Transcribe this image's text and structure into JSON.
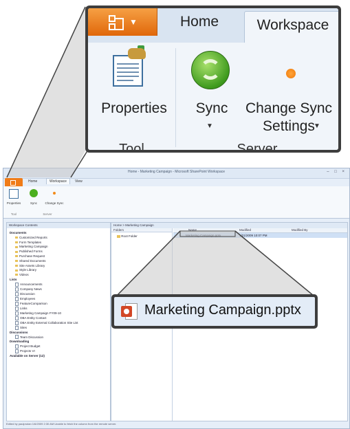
{
  "ribbon": {
    "tabs": [
      "Home",
      "Workspace"
    ],
    "groups": {
      "tool": {
        "name": "Tool",
        "properties_label": "Properties"
      },
      "server": {
        "name": "Server",
        "sync_label": "Sync",
        "change_sync_line1": "Change Sync",
        "change_sync_line2": "Settings"
      }
    },
    "file_button_icon": "office-file-menu-icon",
    "colors": {
      "file_button": "#e8720e",
      "sync": "#4caf1f",
      "change_sync_dot": "#f28a1a"
    }
  },
  "window": {
    "title": "Home - Marketing Campaign - Microsoft SharePoint Workspace",
    "tabs": [
      "Home",
      "Workspace",
      "View"
    ],
    "left_panel_header": "Workspace Contents",
    "right_panel_header": "Home > Marketing Campaign",
    "folders_header": "Folders",
    "root_folder": "Root Folder",
    "columns": [
      "Name",
      "Modified",
      "Modified By"
    ],
    "tree": [
      {
        "label": "Documents",
        "kind": "header"
      },
      {
        "label": "Customized Reports",
        "kind": "folder"
      },
      {
        "label": "Form Templates",
        "kind": "folder"
      },
      {
        "label": "Marketing Campaign",
        "kind": "folder"
      },
      {
        "label": "Published Forms",
        "kind": "folder"
      },
      {
        "label": "Purchase Request",
        "kind": "folder"
      },
      {
        "label": "Shared Documents",
        "kind": "folder"
      },
      {
        "label": "Site Assets Library",
        "kind": "folder"
      },
      {
        "label": "Style Library",
        "kind": "folder"
      },
      {
        "label": "Videos",
        "kind": "folder"
      },
      {
        "label": "Lists",
        "kind": "header"
      },
      {
        "label": "Announcements",
        "kind": "doc"
      },
      {
        "label": "Company News",
        "kind": "doc"
      },
      {
        "label": "Discussion",
        "kind": "doc"
      },
      {
        "label": "Employees",
        "kind": "doc"
      },
      {
        "label": "FeatureComparison",
        "kind": "doc"
      },
      {
        "label": "Links",
        "kind": "doc"
      },
      {
        "label": "Marketing Campaign FY09-10",
        "kind": "doc"
      },
      {
        "label": "OBA Entity Contact",
        "kind": "doc"
      },
      {
        "label": "OBA Entity External Collaboration Site List",
        "kind": "doc"
      },
      {
        "label": "Sites",
        "kind": "doc"
      },
      {
        "label": "Discussions",
        "kind": "header"
      },
      {
        "label": "Team Discussion",
        "kind": "doc"
      },
      {
        "label": "Downloading",
        "kind": "header"
      },
      {
        "label": "Project Budget",
        "kind": "doc"
      },
      {
        "label": "Projects VI",
        "kind": "doc"
      },
      {
        "label": "Available on Server (12)",
        "kind": "header"
      }
    ],
    "file_row": {
      "name": "Marketing Campaign.pptx",
      "modified": "1/21/2009 10:07 PM"
    },
    "status": "Edited by paulprutan 1/6/2009 2:30 AM  Unable to fetch the column from the remote server."
  },
  "callout": {
    "file_name": "Marketing Campaign.pptx",
    "file_icon": "powerpoint-file-icon"
  }
}
